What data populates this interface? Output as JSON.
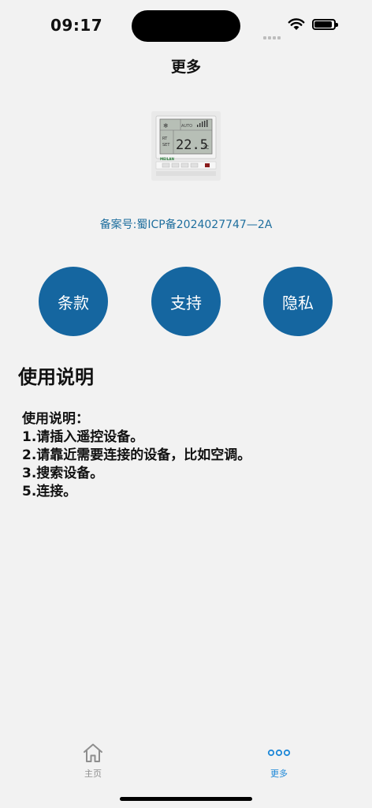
{
  "status_bar": {
    "time": "09:17"
  },
  "nav": {
    "title": "更多"
  },
  "record_number": "备案号:蜀ICP备2024027747—2A",
  "device_screen": {
    "temperature": "22.5",
    "unit": "°C",
    "mode": "AUTO",
    "brand": "MEILAN"
  },
  "buttons": [
    {
      "label": "条款"
    },
    {
      "label": "支持"
    },
    {
      "label": "隐私"
    }
  ],
  "usage": {
    "title": "使用说明",
    "lines": [
      "使用说明：",
      "1.请插入遥控设备。",
      "2.请靠近需要连接的设备，比如空调。",
      "3.搜索设备。",
      "5.连接。"
    ]
  },
  "tabs": [
    {
      "label": "主页",
      "icon": "home-icon",
      "active": false
    },
    {
      "label": "更多",
      "icon": "more-dots-icon",
      "active": true
    }
  ],
  "colors": {
    "accent": "#1566a0",
    "link": "#1f6f9e",
    "tab_active": "#1e88d8",
    "tab_inactive": "#8e8e8e"
  }
}
